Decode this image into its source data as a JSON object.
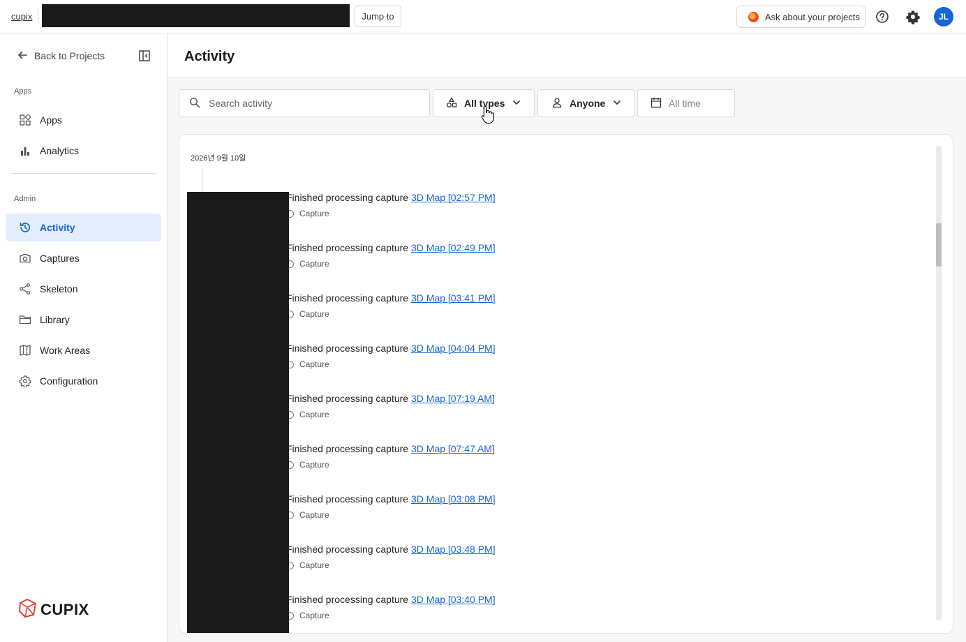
{
  "topbar": {
    "brand": "cupix",
    "jump_label": "Jump to",
    "ask_label": "Ask about your projects",
    "avatar_initials": "JL",
    "avatar_color": "#1565d8",
    "icons": [
      "help-icon",
      "settings-icon"
    ]
  },
  "sidebar": {
    "back_label": "Back to Projects",
    "apps_section": "Apps",
    "apps_items": [
      {
        "label": "Apps",
        "icon": "apps-grid-icon"
      },
      {
        "label": "Analytics",
        "icon": "bar-chart-icon"
      }
    ],
    "admin_section": "Admin",
    "admin_items": [
      {
        "label": "Activity",
        "icon": "history-icon",
        "active": true
      },
      {
        "label": "Captures",
        "icon": "camera-icon"
      },
      {
        "label": "Skeleton",
        "icon": "share-nodes-icon"
      },
      {
        "label": "Library",
        "icon": "folder-icon"
      },
      {
        "label": "Work Areas",
        "icon": "map-icon"
      },
      {
        "label": "Configuration",
        "icon": "gear-icon"
      }
    ],
    "logo_text": "CUPIX"
  },
  "main": {
    "title": "Activity",
    "filters": {
      "search_placeholder": "Search activity",
      "types_label": "All types",
      "anyone_label": "Anyone",
      "time_label": "All time"
    },
    "date_group": "2026년 9월 10일",
    "entries": [
      {
        "text": "Finished processing capture ",
        "link": "3D Map [02:57 PM]",
        "tag": "Capture"
      },
      {
        "text": "Finished processing capture ",
        "link": "3D Map [02:49 PM]",
        "tag": "Capture"
      },
      {
        "text": "Finished processing capture ",
        "link": "3D Map [03:41 PM]",
        "tag": "Capture"
      },
      {
        "text": "Finished processing capture ",
        "link": "3D Map [04:04 PM]",
        "tag": "Capture"
      },
      {
        "text": "Finished processing capture ",
        "link": "3D Map [07:19 AM]",
        "tag": "Capture"
      },
      {
        "text": "Finished processing capture ",
        "link": "3D Map [07:47 AM]",
        "tag": "Capture"
      },
      {
        "text": "Finished processing capture ",
        "link": "3D Map [03:08 PM]",
        "tag": "Capture"
      },
      {
        "text": "Finished processing capture ",
        "link": "3D Map [03:48 PM]",
        "tag": "Capture"
      },
      {
        "text": "Finished processing capture ",
        "link": "3D Map [03:40 PM]",
        "tag": "Capture"
      }
    ]
  },
  "colors": {
    "accent": "#1565d8",
    "active_bg": "#e3edfb"
  }
}
